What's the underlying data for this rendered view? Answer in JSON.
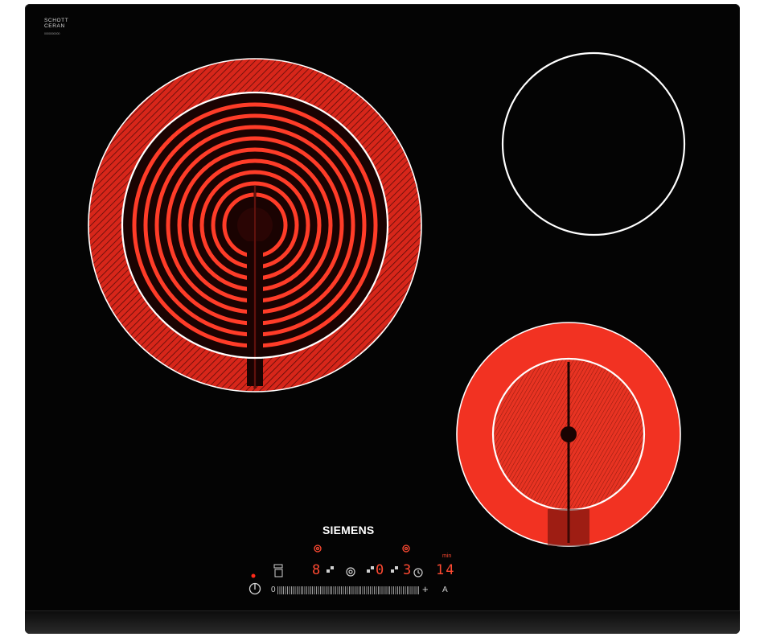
{
  "brand_mark": {
    "line1": "SCHOTT",
    "line2": "CERAN",
    "small": "0000000000"
  },
  "logo": "SIEMENS",
  "colors": {
    "glass": "#040404",
    "coil": "#ff3a26",
    "ring": "#ffffff",
    "display": "#ff4a32"
  },
  "burners": [
    {
      "name": "front-left-zone",
      "state": "on",
      "type": "dual-ring"
    },
    {
      "name": "rear-right-zone",
      "state": "off",
      "type": "single"
    },
    {
      "name": "front-right-zone",
      "state": "on",
      "type": "dual-ring"
    }
  ],
  "controls": {
    "power_icon": "power-icon",
    "slider_min": "0",
    "slider_plus": "+",
    "auto_label": "A",
    "zone1_level": "8",
    "zone2_level": "0",
    "zone3_level": "3",
    "timer_value": "14",
    "timer_unit": "min"
  }
}
